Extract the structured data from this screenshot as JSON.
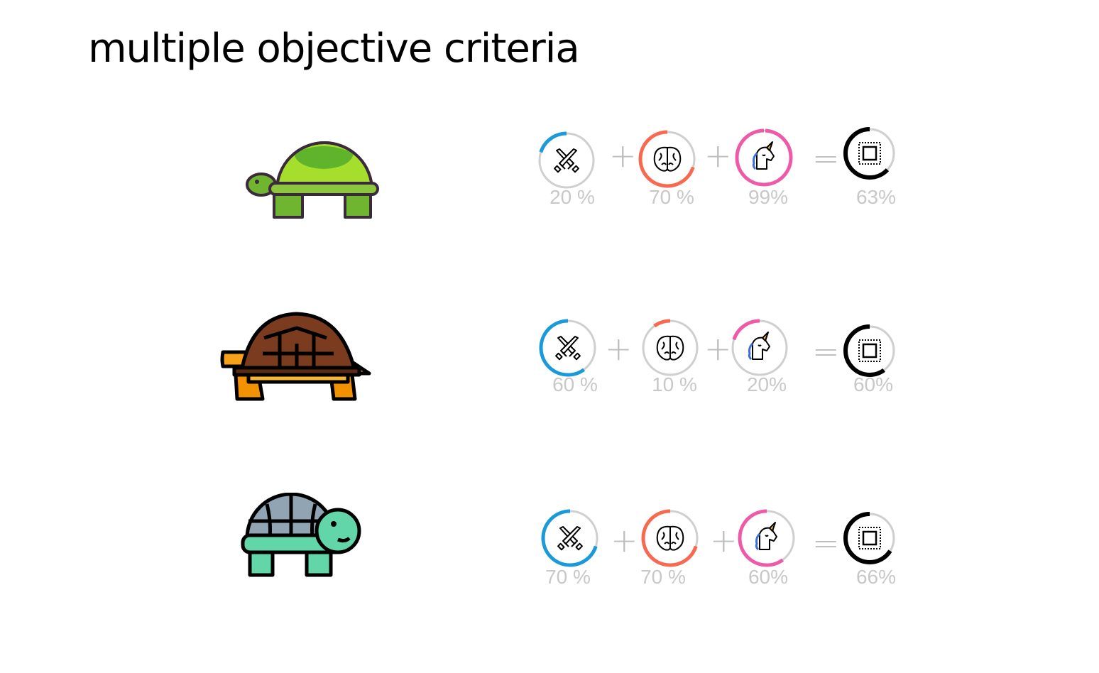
{
  "title": "multiple objective criteria",
  "colors": {
    "attack": "#1a9ad9",
    "intelligence": "#f76a4f",
    "magic": "#ef5aa8",
    "total": "#000000",
    "track": "#cfcfcf"
  },
  "criteria_icons": [
    "crossed-swords-icon",
    "brain-icon",
    "unicorn-icon",
    "chip-icon"
  ],
  "operators": {
    "plus": "+",
    "equals": "="
  },
  "rows": [
    {
      "turtle": "green-turtle",
      "scores": [
        {
          "icon": "crossed-swords-icon",
          "value": 0.2,
          "label": "20 %"
        },
        {
          "icon": "brain-icon",
          "value": 0.7,
          "label": "70 %"
        },
        {
          "icon": "unicorn-icon",
          "value": 0.99,
          "label": "99%"
        }
      ],
      "total": {
        "icon": "chip-icon",
        "value": 0.63,
        "label": "63%"
      }
    },
    {
      "turtle": "brown-tortoise",
      "scores": [
        {
          "icon": "crossed-swords-icon",
          "value": 0.6,
          "label": "60 %"
        },
        {
          "icon": "brain-icon",
          "value": 0.1,
          "label": "10 %"
        },
        {
          "icon": "unicorn-icon",
          "value": 0.2,
          "label": "20%"
        }
      ],
      "total": {
        "icon": "chip-icon",
        "value": 0.6,
        "label": "60%"
      }
    },
    {
      "turtle": "teal-turtle",
      "scores": [
        {
          "icon": "crossed-swords-icon",
          "value": 0.7,
          "label": "70 %"
        },
        {
          "icon": "brain-icon",
          "value": 0.7,
          "label": "70 %"
        },
        {
          "icon": "unicorn-icon",
          "value": 0.6,
          "label": "60%"
        }
      ],
      "total": {
        "icon": "chip-icon",
        "value": 0.66,
        "label": "66%"
      }
    }
  ]
}
